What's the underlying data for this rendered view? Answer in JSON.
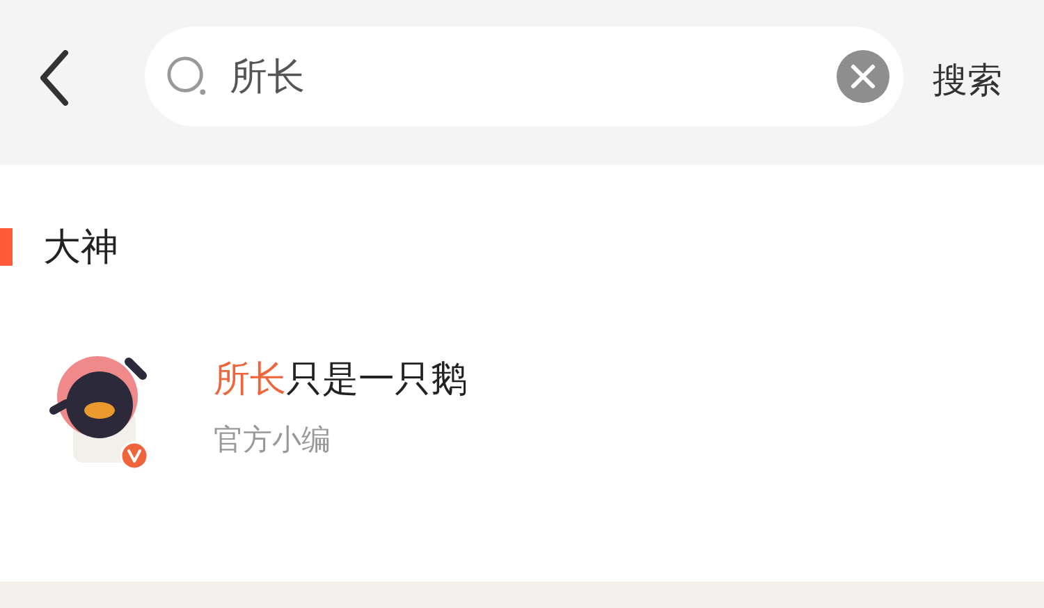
{
  "search": {
    "value": "所长",
    "clearable": true
  },
  "search_button": "搜索",
  "section": {
    "title": "大神"
  },
  "users": [
    {
      "name_parts": [
        {
          "text": "所长",
          "highlighted": true
        },
        {
          "text": "只是一只鹅",
          "highlighted": false
        }
      ],
      "role": "官方小编",
      "verified": true
    }
  ]
}
